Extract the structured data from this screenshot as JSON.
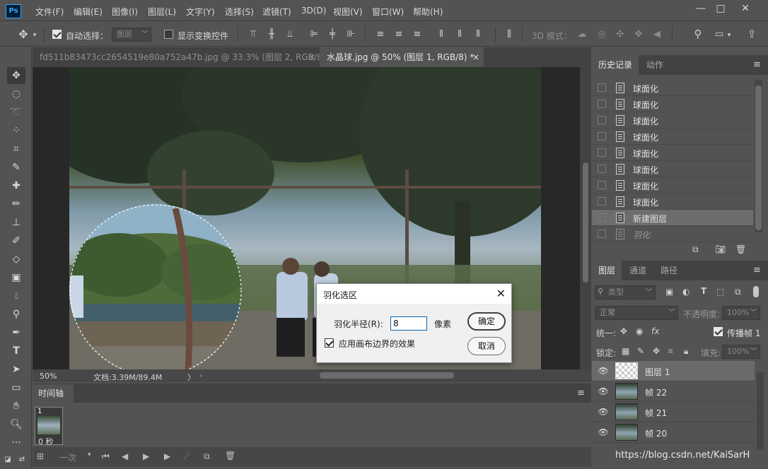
{
  "app": {
    "logo": "Ps"
  },
  "menu": [
    "文件(F)",
    "编辑(E)",
    "图像(I)",
    "图层(L)",
    "文字(Y)",
    "选择(S)",
    "滤镜(T)",
    "3D(D)",
    "视图(V)",
    "窗口(W)",
    "帮助(H)"
  ],
  "window_controls": {
    "minimize": "—",
    "restore": "□",
    "close": "✕"
  },
  "options": {
    "auto_select_label": "自动选择：",
    "auto_select_checked": true,
    "auto_select_target": "图层",
    "show_transform_label": "显示变换控件",
    "show_transform_checked": false,
    "mode_3d_label": "3D 模式："
  },
  "doc_tabs": [
    {
      "title": "fd511b83473cc2654519e80a752a47b.jpg @ 33.3% (图层 2, RGB/8) *",
      "active": false
    },
    {
      "title": "水晶球.jpg @ 50% (图层 1, RGB/8) *",
      "active": true
    }
  ],
  "tab_close_glyph": "×",
  "status": {
    "zoom": "50%",
    "doc_size": "文档:3.39M/89.4M",
    "arrow": "〉"
  },
  "timeline": {
    "tab_label": "时间轴",
    "frame_number": "1",
    "frame_delay": "0 秒",
    "loop_option": "一次"
  },
  "history_panel": {
    "tabs": [
      "历史记录",
      "动作"
    ],
    "items": [
      {
        "label": "球面化",
        "selected": false
      },
      {
        "label": "球面化",
        "selected": false
      },
      {
        "label": "球面化",
        "selected": false
      },
      {
        "label": "球面化",
        "selected": false
      },
      {
        "label": "球面化",
        "selected": false
      },
      {
        "label": "球面化",
        "selected": false
      },
      {
        "label": "球面化",
        "selected": false
      },
      {
        "label": "球面化",
        "selected": false
      },
      {
        "label": "新建图层",
        "selected": true
      },
      {
        "label": "羽化",
        "greyed": true
      }
    ]
  },
  "layers_panel": {
    "tabs": [
      "图层",
      "通道",
      "路径"
    ],
    "filter_label": "类型",
    "blend_mode": "正常",
    "opacity_label": "不透明度:",
    "opacity_value": "100%",
    "unify_label": "统一:",
    "propagate_label": "传播帧 1",
    "lock_label": "锁定:",
    "fill_label": "填充:",
    "fill_value": "100%",
    "layers": [
      {
        "name": "图层 1",
        "selected": true,
        "transparent": true
      },
      {
        "name": "帧 22",
        "selected": false
      },
      {
        "name": "帧 21",
        "selected": false
      },
      {
        "name": "帧 20",
        "selected": false
      }
    ]
  },
  "dialog": {
    "title": "羽化选区",
    "radius_label": "羽化半径(R):",
    "radius_value": "8",
    "unit": "像素",
    "apply_canvas_label": "应用画布边界的效果",
    "apply_canvas_checked": true,
    "ok_label": "确定",
    "cancel_label": "取消",
    "close_glyph": "✕"
  },
  "watermark": "https://blog.csdn.net/KaiSarH",
  "colors": {
    "ui_bg": "#535353",
    "panel_dark": "#424242",
    "canvas_bg": "#282828",
    "ps_blue": "#31a8ff"
  }
}
